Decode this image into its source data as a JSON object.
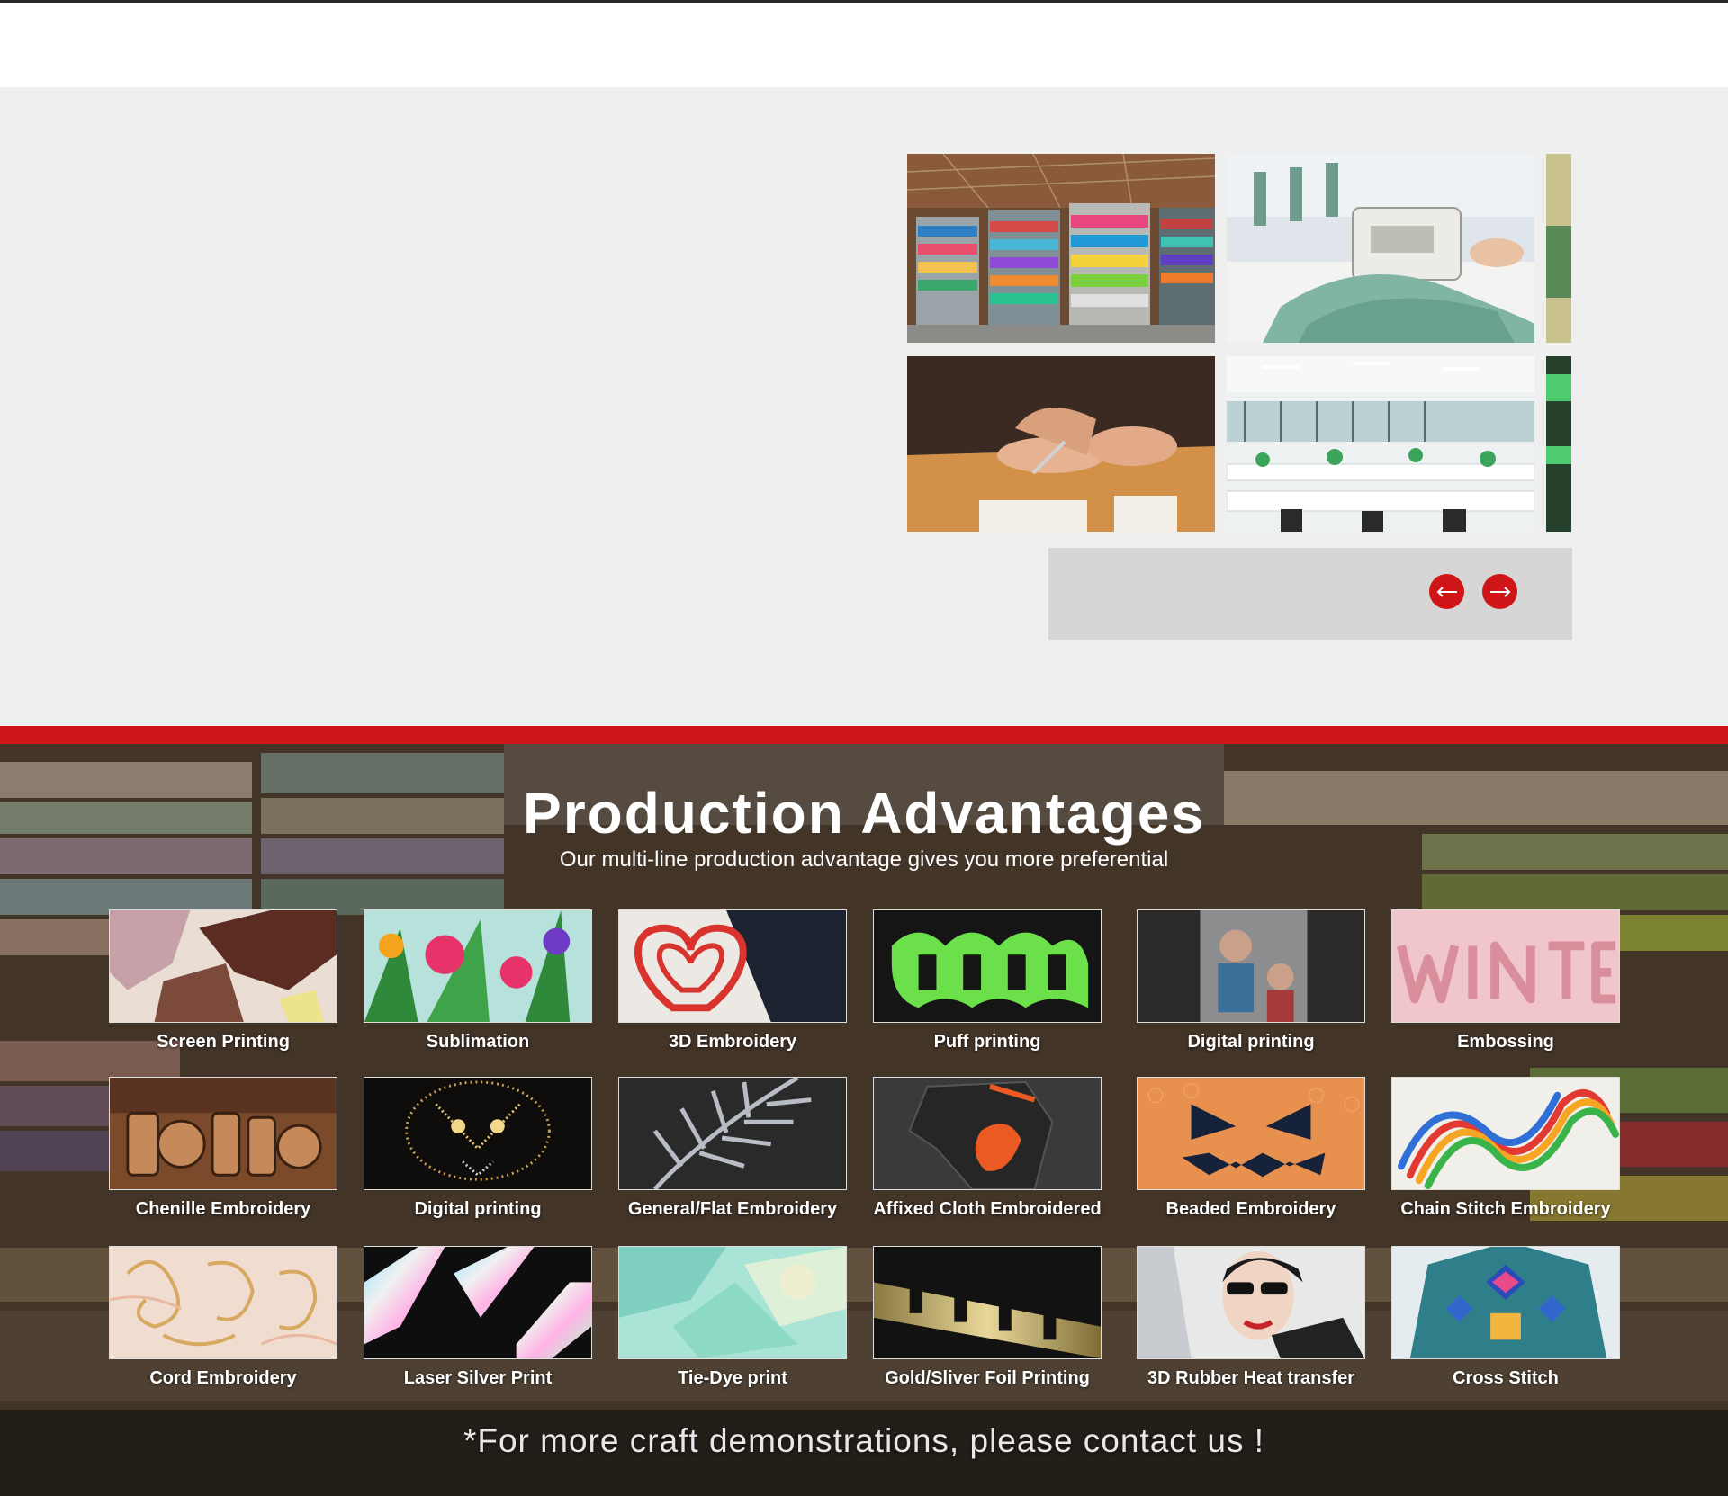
{
  "gallery": {
    "images": [
      {
        "icon": "fabric-warehouse-photo"
      },
      {
        "icon": "sewing-machine-photo"
      },
      {
        "icon": "pattern-cutting-photo"
      },
      {
        "icon": "office-workspace-photo"
      }
    ],
    "prev_label": "←",
    "next_label": "→"
  },
  "advantages": {
    "title": "Production Advantages",
    "subtitle": "Our multi-line production advantage gives you more preferential",
    "crafts": [
      {
        "label": "Screen Printing"
      },
      {
        "label": "Sublimation"
      },
      {
        "label": "3D Embroidery"
      },
      {
        "label": "Puff printing"
      },
      {
        "label": "Digital printing"
      },
      {
        "label": "Embossing"
      },
      {
        "label": "Chenille Embroidery"
      },
      {
        "label": "Digital printing"
      },
      {
        "label": "General/Flat Embroidery"
      },
      {
        "label": "Affixed Cloth Embroidered"
      },
      {
        "label": "Beaded Embroidery"
      },
      {
        "label": "Chain Stitch Embroidery"
      },
      {
        "label": "Cord Embroidery"
      },
      {
        "label": "Laser Silver Print"
      },
      {
        "label": "Tie-Dye print"
      },
      {
        "label": "Gold/Sliver Foil Printing"
      },
      {
        "label": "3D Rubber Heat transfer"
      },
      {
        "label": "Cross Stitch"
      }
    ],
    "footnote": "*For more craft demonstrations, please contact us !"
  },
  "colors": {
    "accent": "#cf1518",
    "section_bg": "#efefef",
    "slider_panel": "#d6d6d6"
  }
}
